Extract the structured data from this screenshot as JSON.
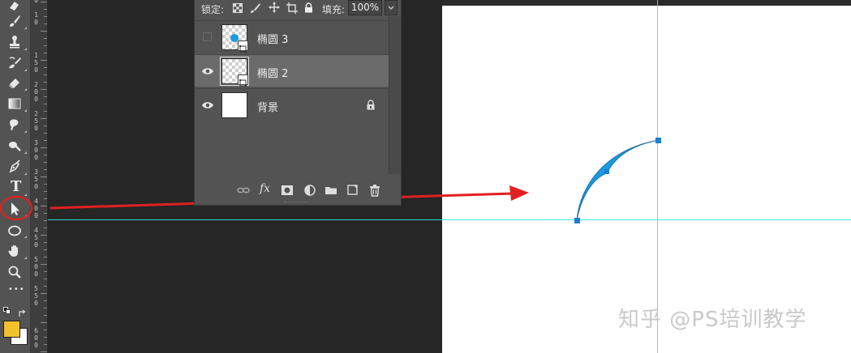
{
  "toolbar": {
    "tools": [
      {
        "icon": "eraser-icon"
      },
      {
        "icon": "brush-icon"
      },
      {
        "icon": "stamp-icon"
      },
      {
        "icon": "history-brush-icon"
      },
      {
        "icon": "eraser-tool-icon"
      },
      {
        "icon": "gradient-icon"
      },
      {
        "icon": "blur-icon"
      },
      {
        "icon": "dodge-icon"
      },
      {
        "icon": "pen-icon"
      },
      {
        "icon": "type-icon",
        "glyph": "T"
      },
      {
        "icon": "path-selection-icon"
      },
      {
        "icon": "ellipse-icon"
      },
      {
        "icon": "hand-icon"
      },
      {
        "icon": "zoom-icon"
      },
      {
        "icon": "more-icon",
        "glyph": "•••"
      }
    ],
    "foreground_color": "#f2c12e",
    "background_color": "#ffffff",
    "selected_tool": "path-selection-icon"
  },
  "ruler": {
    "labels": [
      "0",
      "1 0",
      "1 5 0",
      "2 0 0",
      "2 5 0",
      "3 0 0",
      "3 5 0",
      "4 0 0",
      "4 5 0",
      "5 0 0",
      "5 5 0",
      "6 0 0"
    ]
  },
  "layers_panel": {
    "lock_label": "锁定:",
    "fill_label": "填充:",
    "fill_value": "100%",
    "layers": [
      {
        "name": "椭圆 3",
        "visible": false,
        "thumb": "checker",
        "selected": false,
        "has_shape_badge": true,
        "has_dot": true,
        "locked": false
      },
      {
        "name": "椭圆 2",
        "visible": true,
        "thumb": "checker",
        "selected": true,
        "has_shape_badge": true,
        "has_dot": false,
        "locked": false
      },
      {
        "name": "背景",
        "visible": true,
        "thumb": "white",
        "selected": false,
        "has_shape_badge": false,
        "has_dot": false,
        "locked": true
      }
    ],
    "footer_buttons": [
      "link-icon",
      "fx-icon",
      "mask-icon",
      "adjustment-icon",
      "folder-icon",
      "new-layer-icon",
      "trash-icon"
    ]
  },
  "canvas": {
    "shape_color": "#1a9be0",
    "guide_color": "#2ee6f0",
    "annotation_color": "#e02020"
  },
  "watermark": "知乎 @PS培训教学"
}
